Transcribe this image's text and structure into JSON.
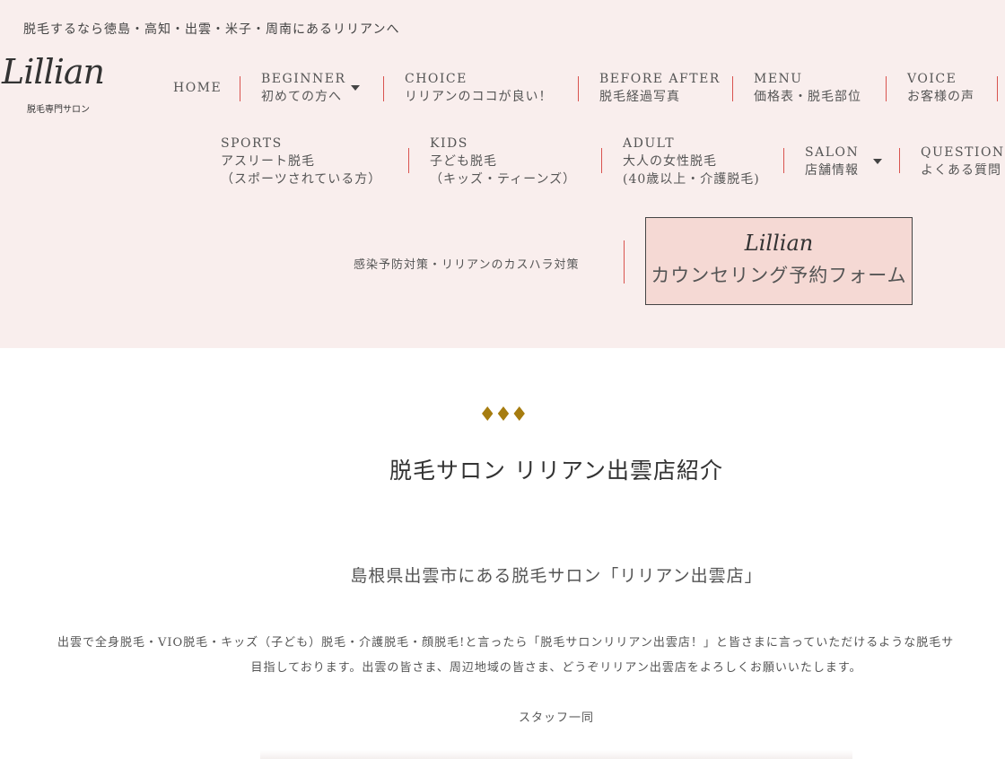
{
  "header": {
    "tagline": "脱毛するなら徳島・高知・出雲・米子・周南にあるリリアンへ",
    "logo_script": "Lillian",
    "logo_sub": "脱毛専門サロン",
    "nav_row1": [
      {
        "en": "HOME",
        "ja": ""
      },
      {
        "en": "BEGINNER",
        "ja": "初めての方へ"
      },
      {
        "en": "CHOICE",
        "ja": "リリアンのココが良い！"
      },
      {
        "en": "BEFORE AFTER",
        "ja": "脱毛経過写真"
      },
      {
        "en": "MENU",
        "ja": "価格表・脱毛部位"
      },
      {
        "en": "VOICE",
        "ja": "お客様の声"
      }
    ],
    "nav_row2": [
      {
        "en": "SPORTS",
        "ja": "アスリート脱毛",
        "ja2": "（スポーツされている方）"
      },
      {
        "en": "KIDS",
        "ja": "子ども脱毛",
        "ja2": "（キッズ・ティーンズ）"
      },
      {
        "en": "ADULT",
        "ja": "大人の女性脱毛",
        "ja2": "(40歳以上・介護脱毛)"
      },
      {
        "en": "SALON",
        "ja": "店舗情報",
        "ja2": ""
      },
      {
        "en": "QUESTION",
        "ja": "よくある質問",
        "ja2": ""
      }
    ],
    "covid_link": "感染予防対策・リリアンのカスハラ対策",
    "cta_logo": "Lillian",
    "cta_label": "カウンセリング予約フォーム"
  },
  "main": {
    "ornament": "♦♦♦",
    "title": "脱毛サロン リリアン出雲店紹介",
    "subtitle": "島根県出雲市にある脱毛サロン「リリアン出雲店」",
    "para1": "出雲で全身脱毛・VIO脱毛・キッズ（子ども）脱毛・介護脱毛・顔脱毛!と言ったら「脱毛サロンリリアン出雲店！」と皆さまに言っていただけるような脱毛サ",
    "para2": "目指しております。出雲の皆さま、周辺地域の皆さま、どうぞリリアン出雲店をよろしくお願いいたします。",
    "staff": "スタッフ一同"
  },
  "colors": {
    "header_bg": "#f9eeed",
    "separator": "#d9534f",
    "cta_bg": "#f5d9d4",
    "ornament": "#a67c0f"
  }
}
